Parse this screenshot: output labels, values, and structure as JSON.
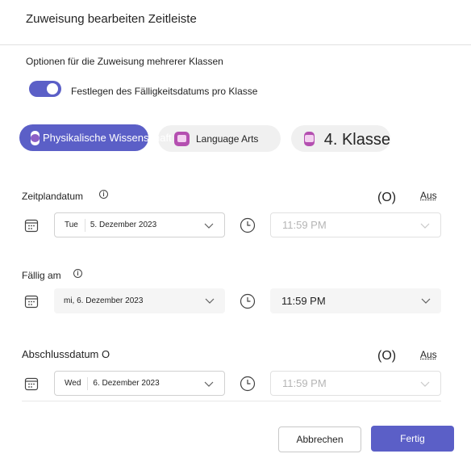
{
  "dialog": {
    "title": "Zuweisung bearbeiten Zeitleiste"
  },
  "options": {
    "section_label": "Optionen für die Zuweisung mehrerer Klassen",
    "toggle_label": "Festlegen des Fälligkeitsdatums pro Klasse",
    "toggle_on": true
  },
  "classes": [
    {
      "label": "Physikalische Wissenschaft",
      "selected": true
    },
    {
      "label": "Language Arts",
      "selected": false
    },
    {
      "label": "4. Klasse",
      "selected": false
    }
  ],
  "rows": [
    {
      "label": "Zeitplandatum",
      "info": "i",
      "o_mark": "(O)",
      "aus": "Aus",
      "weekday": "Tue",
      "date": "5. Dezember 2023",
      "time": "11:59 PM",
      "time_enabled": false
    },
    {
      "label": "Fällig am",
      "info": "i",
      "date_full": "mi, 6. Dezember 2023",
      "time": "11:59 PM",
      "time_enabled": true
    },
    {
      "label": "Abschlussdatum O",
      "o_mark": "(O)",
      "aus": "Aus",
      "weekday": "Wed",
      "date": "6. Dezember 2023",
      "time": "11:59 PM",
      "time_enabled": false
    }
  ],
  "footer": {
    "cancel_label": "Abbrechen",
    "done_label": "Fertig"
  },
  "colors": {
    "accent": "#5b5fc7",
    "class_icon": "#b44fb0"
  }
}
